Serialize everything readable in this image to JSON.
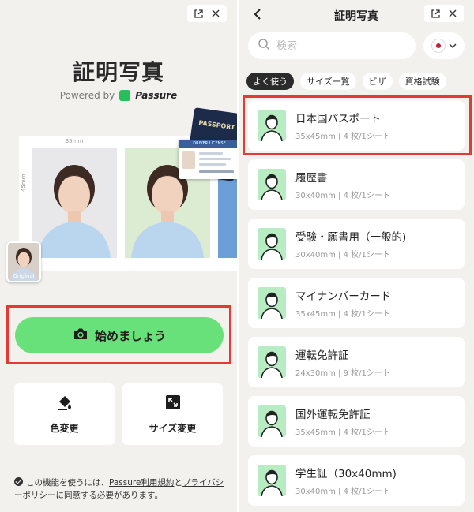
{
  "left": {
    "title": "証明写真",
    "powered_by": "Powered by",
    "brand": "Passure",
    "sample": {
      "width_label": "35mm",
      "height_label": "45mm",
      "passport_label": "PASSPORT",
      "license_label": "DRIVER LICENSE",
      "original_label": "Original"
    },
    "start_label": "始めましょう",
    "tools": [
      {
        "label": "色変更",
        "icon": "paint-bucket-icon"
      },
      {
        "label": "サイズ変更",
        "icon": "resize-icon"
      }
    ],
    "consent": {
      "prefix": "この機能を使うには、",
      "terms_link": "Passure利用規約",
      "middle": "と",
      "privacy_link": "プライバシーポリシー",
      "suffix": "に同意する必要があります。"
    }
  },
  "right": {
    "title": "証明写真",
    "search_placeholder": "検索",
    "country_flag": "japan-flag",
    "tabs": [
      {
        "label": "よく使う",
        "active": true
      },
      {
        "label": "サイズ一覧",
        "active": false
      },
      {
        "label": "ビザ",
        "active": false
      },
      {
        "label": "資格試験",
        "active": false
      }
    ],
    "items": [
      {
        "name": "日本国パスポート",
        "spec": "35x45mm | 4 枚/1シート"
      },
      {
        "name": "履歴書",
        "spec": "30x40mm | 4 枚/1シート"
      },
      {
        "name": "受験・願書用（一般的)",
        "spec": "30x40mm | 4 枚/1シート"
      },
      {
        "name": "マイナンバーカード",
        "spec": "35x45mm | 4 枚/1シート"
      },
      {
        "name": "運転免許証",
        "spec": "24x30mm | 9 枚/1シート"
      },
      {
        "name": "国外運転免許証",
        "spec": "35x45mm | 4 枚/1シート"
      },
      {
        "name": "学生証（30x40mm)",
        "spec": "30x40mm | 4 枚/1シート"
      }
    ]
  },
  "colors": {
    "accent_green": "#69e17a",
    "highlight_red": "#e53935",
    "avatar_bg": "#b8edc3"
  }
}
